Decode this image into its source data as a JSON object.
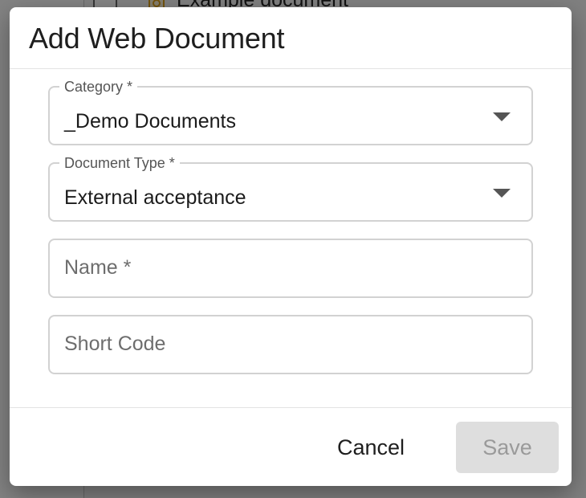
{
  "background": {
    "row_text": "Example document",
    "doc_icon": "document-icon"
  },
  "dialog": {
    "title": "Add Web Document",
    "fields": {
      "category": {
        "label": "Category *",
        "value": "_Demo Documents",
        "icon": "chevron-down-icon"
      },
      "document_type": {
        "label": "Document Type *",
        "value": "External acceptance",
        "icon": "chevron-down-icon"
      },
      "name": {
        "placeholder": "Name *",
        "value": ""
      },
      "short_code": {
        "placeholder": "Short Code",
        "value": ""
      }
    },
    "buttons": {
      "cancel": "Cancel",
      "save": "Save"
    }
  },
  "colors": {
    "overlay": "#707070",
    "dialog_bg": "#ffffff",
    "field_border": "#d2d2d2",
    "save_disabled_bg": "#dedede",
    "save_disabled_text": "#9a9a9a",
    "doc_icon_color": "#e0a21a"
  }
}
